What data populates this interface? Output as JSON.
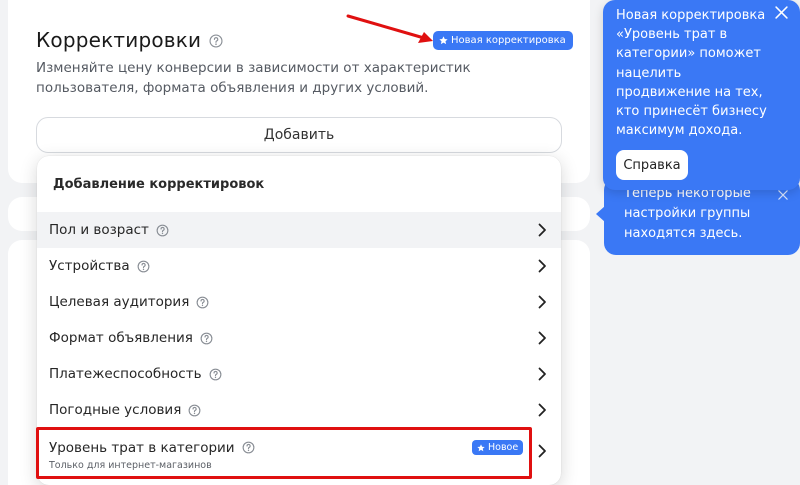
{
  "header": {
    "title": "Корректировки",
    "new_adjustment_badge": "Новая корректировка",
    "description": "Изменяйте цену конверсии в зависимости от характеристик пользователя, формата объявления и других условий.",
    "add_button": "Добавить"
  },
  "dropdown": {
    "header": "Добавление корректировок",
    "items": [
      {
        "label": "Пол и возраст"
      },
      {
        "label": "Устройства"
      },
      {
        "label": "Целевая аудитория"
      },
      {
        "label": "Формат объявления"
      },
      {
        "label": "Платежеспособность"
      },
      {
        "label": "Погодные условия"
      },
      {
        "label": "Уровень трат в категории",
        "sub": "Только для интернет-магазинов",
        "badge": "Новое"
      }
    ]
  },
  "tooltip_main": {
    "text": "Новая корректировка «Уровень трат в категории» поможет нацелить продвижение на тех, кто принесёт бизнесу максимум дохода.",
    "button": "Справка"
  },
  "tooltip_second": {
    "text": "Теперь некоторые настройки группы находятся здесь."
  },
  "colors": {
    "accent": "#3a78f5",
    "highlight": "#e01010",
    "background": "#f2f3f5"
  },
  "icons": {
    "help": "question-circle-icon",
    "chevron": "chevron-right-icon",
    "star": "star-icon",
    "close": "close-icon"
  }
}
